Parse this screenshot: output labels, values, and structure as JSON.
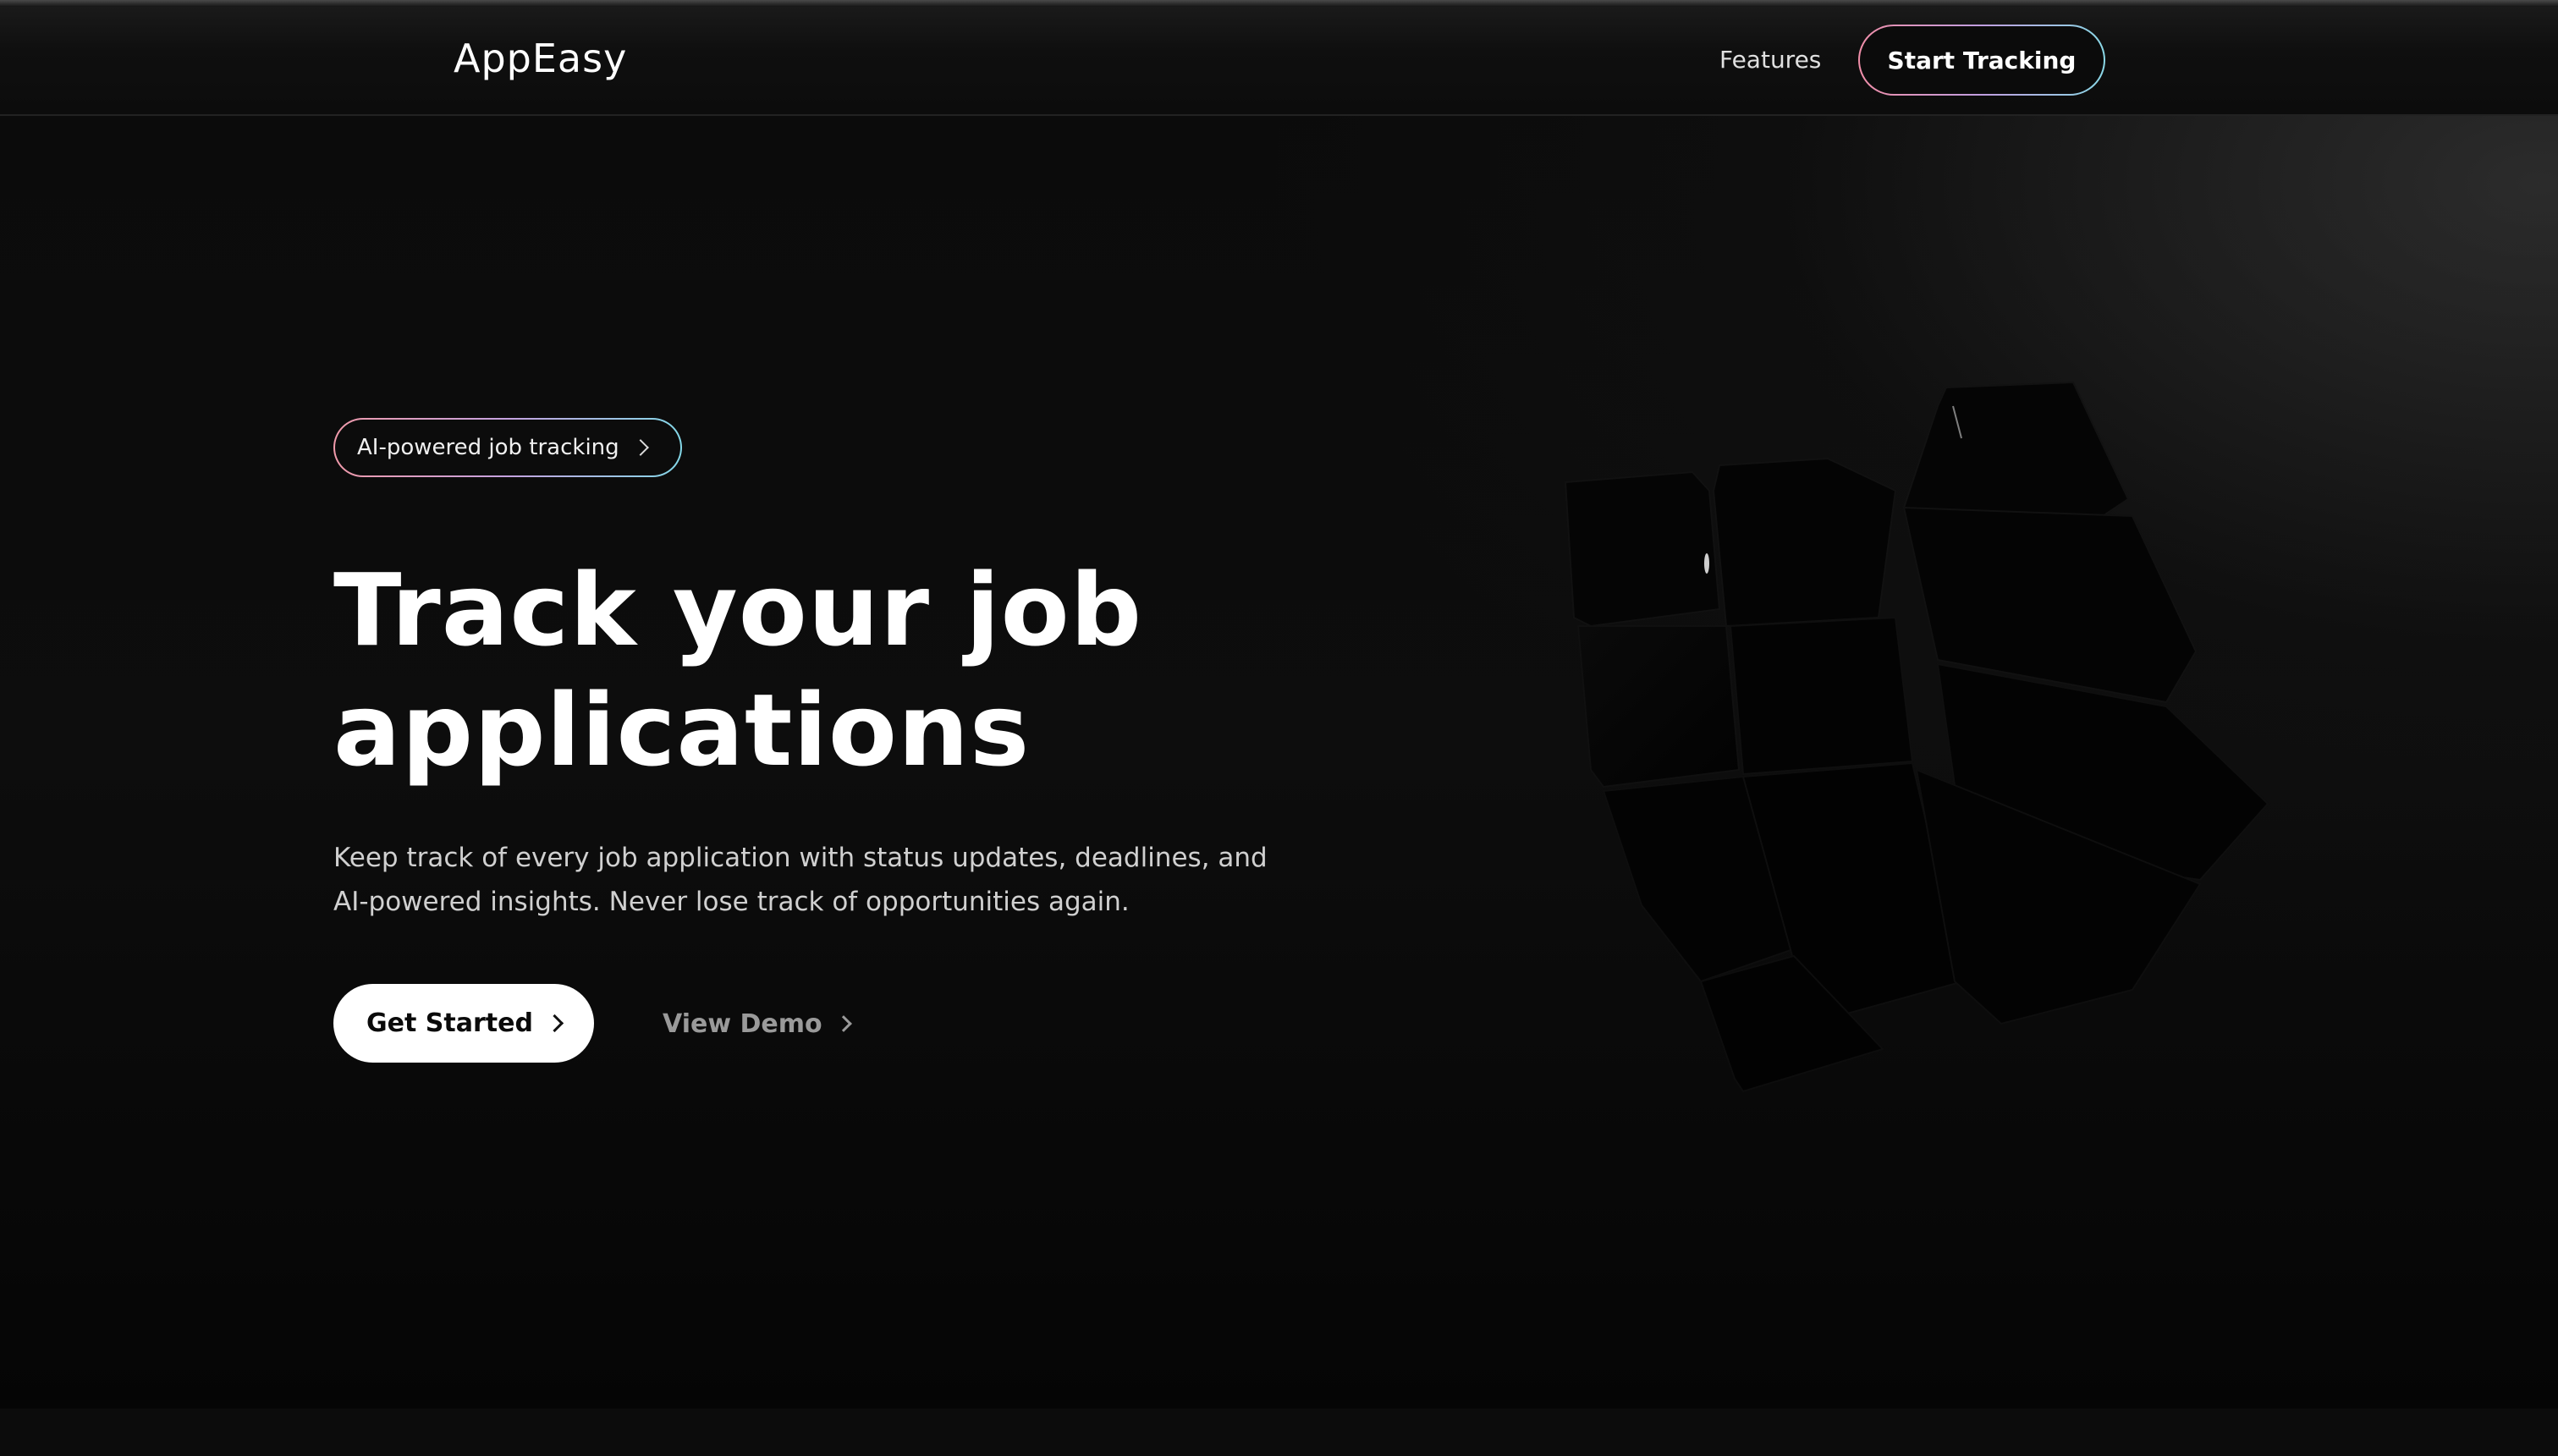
{
  "header": {
    "logo": "AppEasy",
    "nav": {
      "features_label": "Features"
    },
    "cta_label": "Start Tracking"
  },
  "hero": {
    "badge_label": "AI-powered job tracking",
    "headline_line1": "Track your job",
    "headline_line2": "applications",
    "subtext_line1": "Keep track of every job application with status updates, deadlines, and",
    "subtext_line2": "AI-powered insights. Never lose track of opportunities again.",
    "primary_button": "Get Started",
    "secondary_button": "View Demo"
  },
  "icons": {
    "badge": "chevron-right-icon",
    "primary": "chevron-right-icon",
    "secondary": "chevron-right-icon",
    "art": "cube-illustration"
  },
  "colors": {
    "background": "#0b0b0b",
    "text": "#ffffff",
    "muted": "#9a9a9a",
    "gradient_start": "#f08ea8",
    "gradient_mid": "#c09ee0",
    "gradient_end": "#8ad8e6"
  }
}
